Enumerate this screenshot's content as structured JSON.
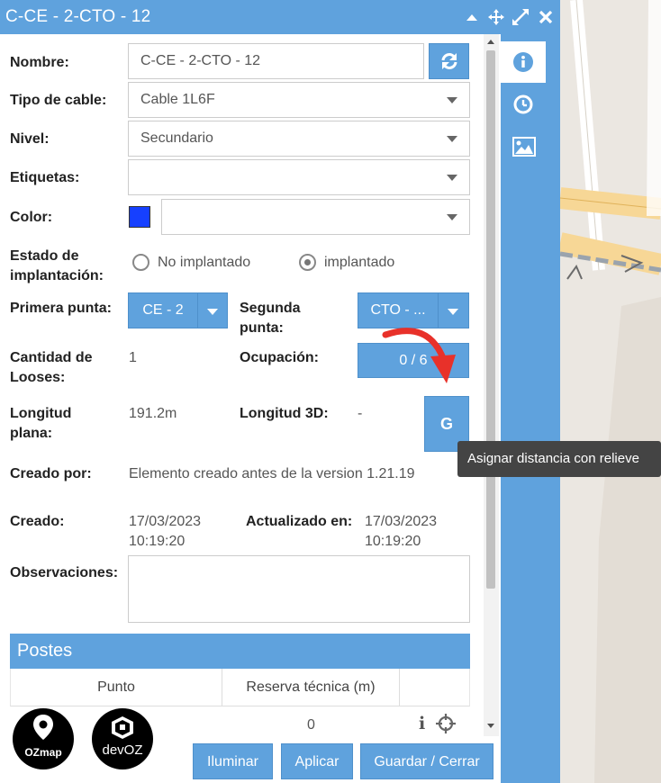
{
  "window": {
    "title": "C-CE - 2-CTO - 12"
  },
  "form": {
    "nombre": {
      "label": "Nombre:",
      "value": "C-CE - 2-CTO - 12"
    },
    "tipo_cable": {
      "label": "Tipo de cable:",
      "value": "Cable 1L6F"
    },
    "nivel": {
      "label": "Nivel:",
      "value": "Secundario"
    },
    "etiquetas": {
      "label": "Etiquetas:",
      "value": ""
    },
    "color": {
      "label": "Color:",
      "swatch": "#1640ff",
      "value": ""
    },
    "estado": {
      "label_line1": "Estado de",
      "label_line2": "implantación:",
      "option1": "No implantado",
      "option2": "implantado",
      "selected": "implantado"
    },
    "primera_punta": {
      "label": "Primera punta:",
      "value": "CE - 2"
    },
    "segunda_punta": {
      "label_line1": "Segunda",
      "label_line2": "punta:",
      "value": "CTO - ..."
    },
    "cantidad_looses": {
      "label_line1": "Cantidad de",
      "label_line2": "Looses:",
      "value": "1"
    },
    "ocupacion": {
      "label": "Ocupación:",
      "value": "0 / 6"
    },
    "longitud_plana": {
      "label_line1": "Longitud",
      "label_line2": "plana:",
      "value": "191.2m"
    },
    "longitud_3d": {
      "label": "Longitud 3D:",
      "value": "-",
      "button": "G"
    },
    "creado_por": {
      "label": "Creado por:",
      "value": "Elemento creado antes de la version 1.21.19"
    },
    "creado": {
      "label": "Creado:",
      "date": "17/03/2023",
      "time": "10:19:20"
    },
    "actualizado": {
      "label": "Actualizado en:",
      "date": "17/03/2023",
      "time": "10:19:20"
    },
    "observaciones": {
      "label": "Observaciones:",
      "value": ""
    }
  },
  "postes": {
    "header": "Postes",
    "columns": [
      "Punto",
      "Reserva técnica (m)"
    ],
    "row_value": "0"
  },
  "tooltip": "Asignar distancia con relieve",
  "footer": {
    "iluminar": "Iluminar",
    "aplicar": "Aplicar",
    "guardar": "Guardar / Cerrar"
  },
  "logos": {
    "ozmap": "OZmap",
    "devoz": "devOZ"
  },
  "colors": {
    "accent": "#5fa2dd",
    "arrow": "#e8312a",
    "tooltip_bg": "#444444"
  }
}
